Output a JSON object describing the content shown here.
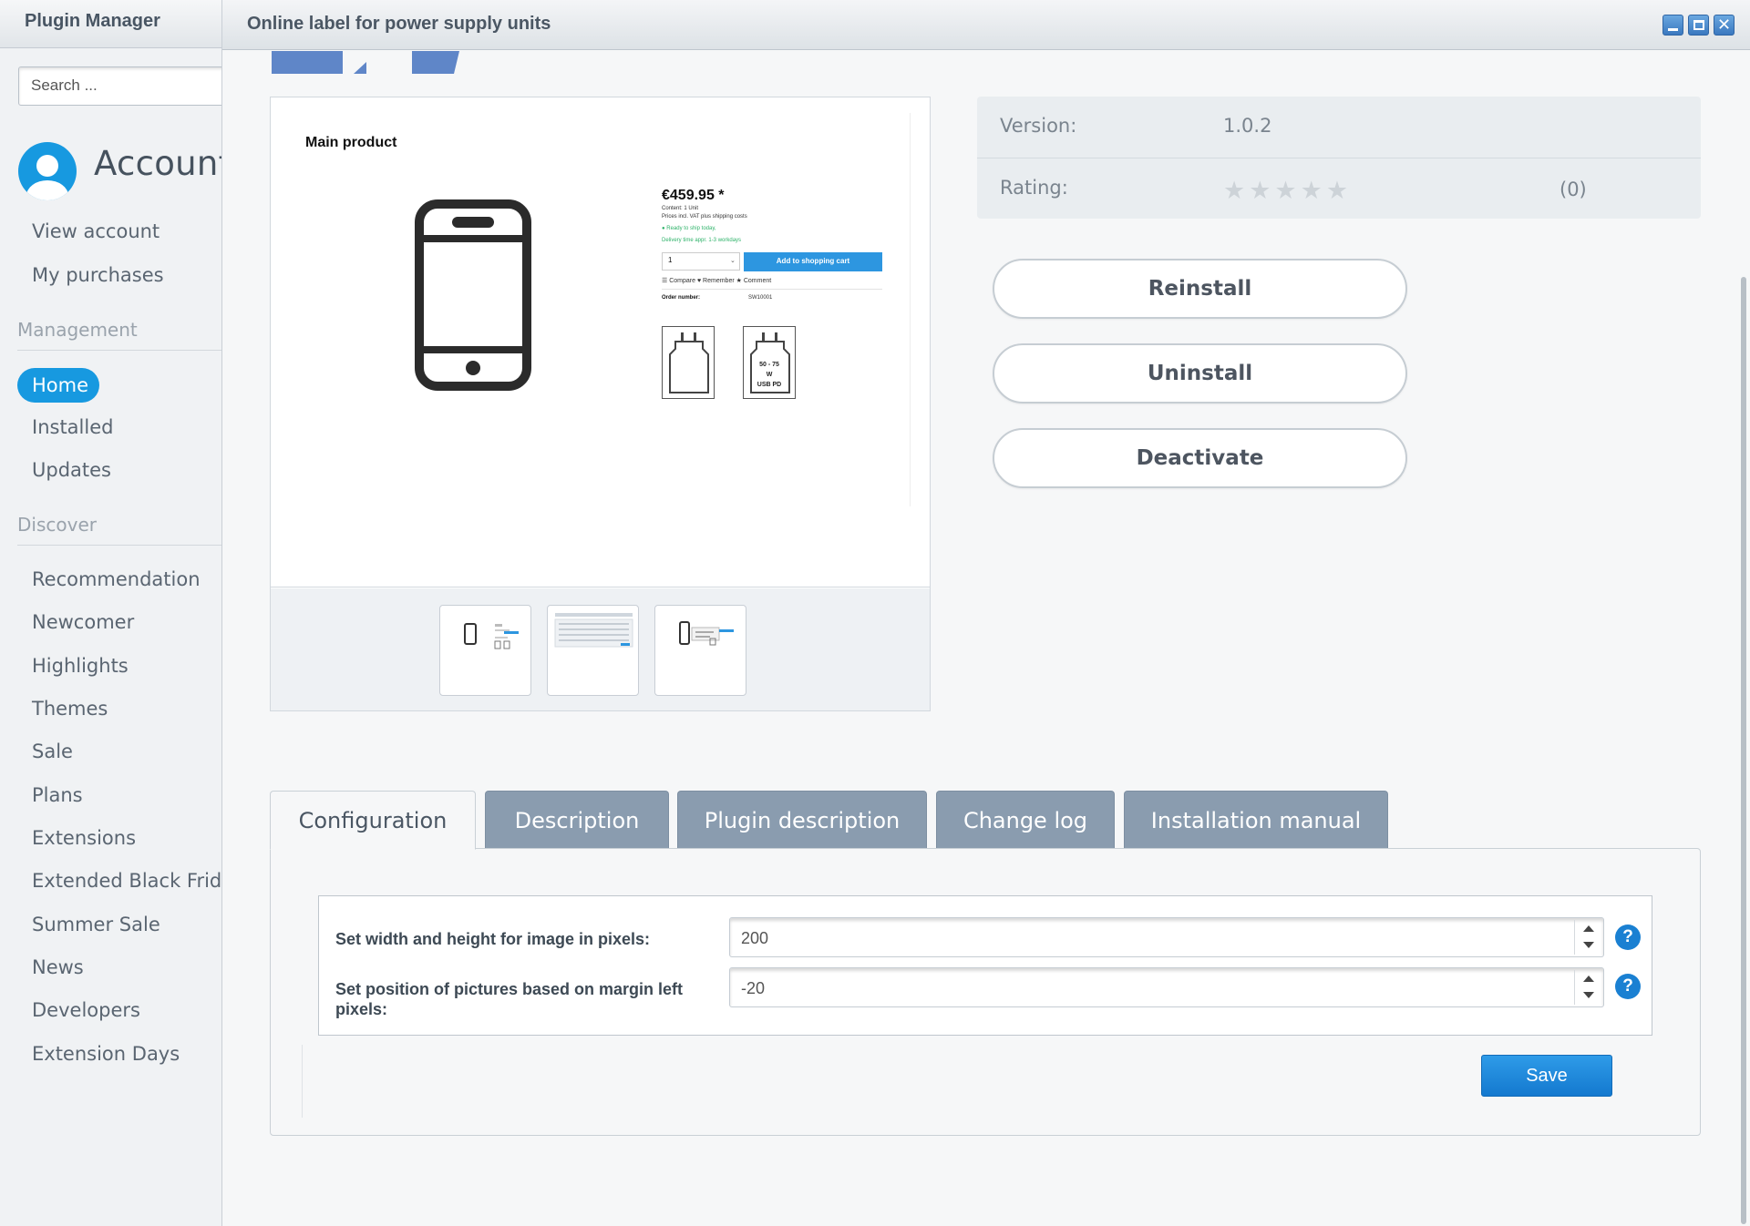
{
  "sidebar": {
    "title": "Plugin Manager",
    "search_placeholder": "Search ...",
    "account_title": "Account",
    "account_items": [
      "View account",
      "My purchases"
    ],
    "management_heading": "Management",
    "management_items": [
      "Home",
      "Installed",
      "Updates"
    ],
    "discover_heading": "Discover",
    "discover_items": [
      "Recommendation",
      "Newcomer",
      "Highlights",
      "Themes",
      "Sale",
      "Plans",
      "Extensions",
      "Extended Black Friday",
      "Summer Sale",
      "News",
      "Developers",
      "Extension Days"
    ]
  },
  "window": {
    "title": "Online label for power supply units"
  },
  "preview": {
    "title": "Main product",
    "price": "€459.95 *",
    "content": "Content: 1 Unit",
    "prices_note": "Prices incl. VAT plus shipping costs",
    "ready": "● Ready to ship today,",
    "delivery": "Delivery time appr. 1-3 workdays",
    "qty": "1",
    "cart": "Add to shopping cart",
    "links": "☰ Compare   ♥ Remember   ★ Comment",
    "order_label": "Order number:",
    "order_value": "SW10001",
    "plug_label": "50 - 75\nW\nUSB PD"
  },
  "info": {
    "version_label": "Version:",
    "version_value": "1.0.2",
    "rating_label": "Rating:",
    "rating_stars": "★★★★★",
    "rating_count": "(0)",
    "rating_value": 0
  },
  "actions": {
    "reinstall": "Reinstall",
    "uninstall": "Uninstall",
    "deactivate": "Deactivate"
  },
  "tabs": [
    "Configuration",
    "Description",
    "Plugin description",
    "Change log",
    "Installation manual"
  ],
  "config": {
    "width_label": "Set width and height for image in pixels:",
    "width_value": "200",
    "margin_label": "Set position of pictures based on margin left pixels:",
    "margin_value": "-20",
    "help_glyph": "?",
    "save_label": "Save"
  },
  "colors": {
    "accent": "#1799e0",
    "tab_inactive": "#8a9caf",
    "save": "#1e88dc"
  }
}
